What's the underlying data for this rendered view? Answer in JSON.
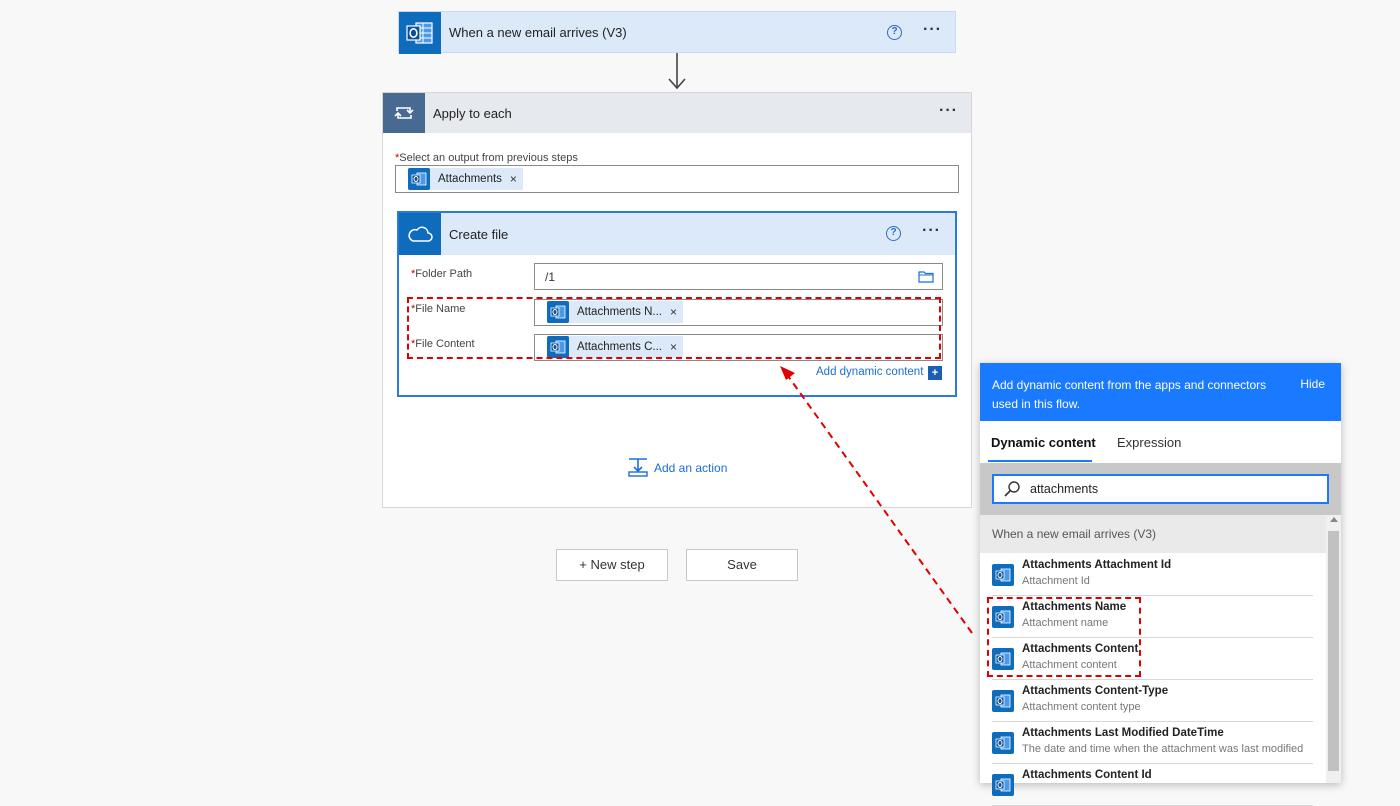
{
  "trigger": {
    "title": "When a new email arrives (V3)",
    "help": "?",
    "more": "···"
  },
  "apply": {
    "title": "Apply to each",
    "more": "···",
    "output_label": "Select an output from previous steps",
    "required_mark": "*",
    "output_token": "Attachments",
    "token_remove": "×"
  },
  "create_file": {
    "title": "Create file",
    "help": "?",
    "more": "···",
    "fields": [
      {
        "label": "Folder Path",
        "value": "/1"
      },
      {
        "label": "File Name",
        "token": "Attachments N..."
      },
      {
        "label": "File Content",
        "token": "Attachments C..."
      }
    ],
    "add_dynamic": "Add dynamic content",
    "add_dynamic_icon": "+"
  },
  "add_action": "Add an action",
  "buttons": {
    "new_step": "+ New step",
    "save": "Save"
  },
  "panel": {
    "description": "Add dynamic content from the apps and connectors used in this flow.",
    "hide": "Hide",
    "tabs": [
      "Dynamic content",
      "Expression"
    ],
    "search_value": "attachments",
    "group_title": "When a new email arrives (V3)",
    "items": [
      {
        "name": "Attachments Attachment Id",
        "sub": "Attachment Id"
      },
      {
        "name": "Attachments Name",
        "sub": "Attachment name"
      },
      {
        "name": "Attachments Content",
        "sub": "Attachment content"
      },
      {
        "name": "Attachments Content-Type",
        "sub": "Attachment content type"
      },
      {
        "name": "Attachments Last Modified DateTime",
        "sub": "The date and time when the attachment was last modified"
      },
      {
        "name": "Attachments Content Id",
        "sub": ""
      }
    ]
  },
  "colors": {
    "accent": "#1979ff",
    "highlight": "#e00000",
    "outlook": "#0f6cbd",
    "loop": "#486991"
  },
  "icons": [
    "outlook-icon",
    "loop-icon",
    "onedrive-cloud-icon",
    "folder-icon",
    "add-action-icon",
    "search-icon"
  ]
}
